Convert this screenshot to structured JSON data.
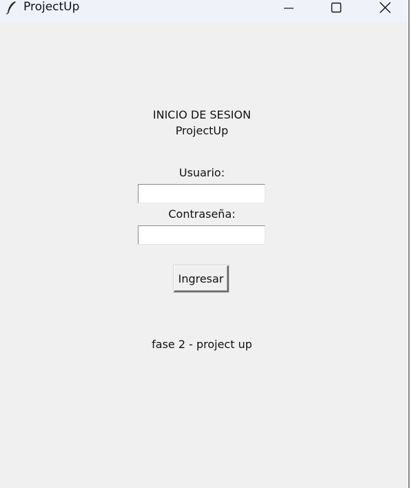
{
  "window": {
    "title": "ProjectUp",
    "icon": "feather-icon",
    "controls": [
      "minimize-icon",
      "maximize-icon",
      "close-icon"
    ]
  },
  "login": {
    "heading": "INICIO DE SESION",
    "heading_sub": "ProjectUp",
    "user_label": "Usuario:",
    "user_value": "",
    "password_label": "Contraseña:",
    "password_value": "",
    "submit_label": "Ingresar"
  },
  "footer": {
    "text": "fase 2 - project up"
  }
}
